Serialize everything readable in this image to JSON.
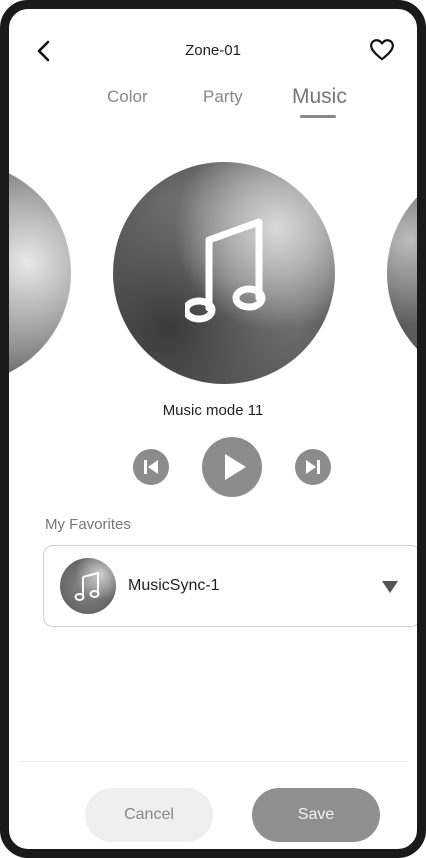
{
  "header": {
    "title": "Zone-01",
    "back_icon": "chevron-left-icon",
    "favorite_icon": "heart-outline-icon"
  },
  "tabs": [
    {
      "label": "Color",
      "active": false
    },
    {
      "label": "Party",
      "active": false
    },
    {
      "label": "Music",
      "active": true
    }
  ],
  "player": {
    "mode_name": "Music mode 11",
    "disc_icon": "music-note-icon",
    "controls": [
      "skip-previous-icon",
      "play-icon",
      "skip-next-icon"
    ]
  },
  "favorites": {
    "label": "My Favorites",
    "selected": "MusicSync-1",
    "item_icon": "music-note-icon"
  },
  "footer": {
    "cancel_label": "Cancel",
    "save_label": "Save"
  },
  "colors": {
    "primary_gray": "#8f8f8f",
    "text": "#222222",
    "muted": "#888888"
  }
}
